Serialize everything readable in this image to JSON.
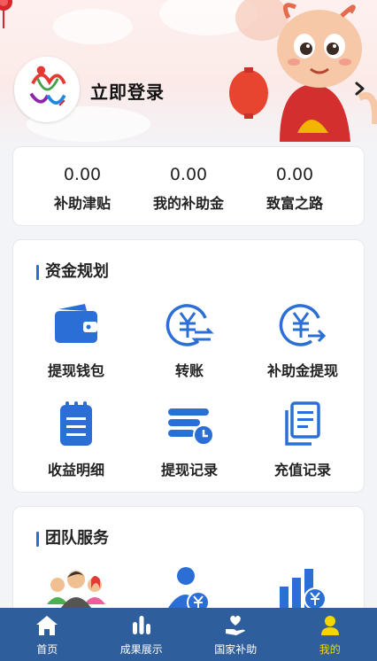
{
  "profile": {
    "login_text": "立即登录"
  },
  "stats": [
    {
      "value": "0.00",
      "label": "补助津贴"
    },
    {
      "value": "0.00",
      "label": "我的补助金"
    },
    {
      "value": "0.00",
      "label": "致富之路"
    }
  ],
  "funds": {
    "title": "资金规划",
    "items": [
      {
        "label": "提现钱包",
        "icon": "wallet-icon"
      },
      {
        "label": "转账",
        "icon": "yuan-transfer-icon"
      },
      {
        "label": "补助金提现",
        "icon": "yuan-withdraw-icon"
      },
      {
        "label": "收益明细",
        "icon": "clipboard-list-icon"
      },
      {
        "label": "提现记录",
        "icon": "coins-clock-icon"
      },
      {
        "label": "充值记录",
        "icon": "documents-icon"
      }
    ]
  },
  "team": {
    "title": "团队服务",
    "items": [
      {
        "icon": "team-people-icon"
      },
      {
        "icon": "person-yuan-icon"
      },
      {
        "icon": "bar-chart-yuan-icon"
      }
    ]
  },
  "tabbar": {
    "items": [
      {
        "label": "首页",
        "icon": "home-icon"
      },
      {
        "label": "成果展示",
        "icon": "bar-chart-icon"
      },
      {
        "label": "国家补助",
        "icon": "heart-hand-icon"
      },
      {
        "label": "我的",
        "icon": "user-icon",
        "active": true
      }
    ]
  },
  "colors": {
    "accent_blue": "#2b6fd6",
    "tabbar_bg": "#2f5e9c",
    "tab_active": "#f5d600"
  }
}
